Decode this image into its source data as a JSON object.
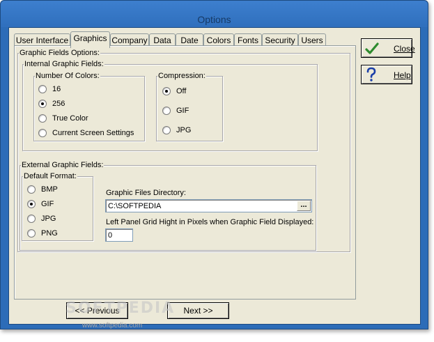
{
  "window": {
    "title": "Options"
  },
  "tabs": [
    {
      "label": "User Interface",
      "active": false
    },
    {
      "label": "Graphics",
      "active": true
    },
    {
      "label": "Company",
      "active": false
    },
    {
      "label": "Data",
      "active": false
    },
    {
      "label": "Date",
      "active": false
    },
    {
      "label": "Colors",
      "active": false
    },
    {
      "label": "Fonts",
      "active": false
    },
    {
      "label": "Security",
      "active": false
    },
    {
      "label": "Users",
      "active": false
    }
  ],
  "graphic_fields": {
    "title": "Graphic Fields Options:",
    "internal": {
      "title": "Internal Graphic Fields:",
      "colors": {
        "title": "Number Of Colors:",
        "options": [
          "16",
          "256",
          "True Color",
          "Current Screen Settings"
        ],
        "selected": "256"
      },
      "compression": {
        "title": "Compression:",
        "options": [
          "Off",
          "GIF",
          "JPG"
        ],
        "selected": "Off"
      }
    },
    "external": {
      "title": "External Graphic Fields:",
      "format": {
        "title": "Default Format:",
        "options": [
          "BMP",
          "GIF",
          "JPG",
          "PNG"
        ],
        "selected": "GIF"
      },
      "directory_label": "Graphic Files Directory:",
      "directory_value": "C:\\SOFTPEDIA",
      "browse_label": "...",
      "grid_height_label": "Left Panel Grid Hight in Pixels when Graphic Field Displayed:",
      "grid_height_value": "0"
    }
  },
  "buttons": {
    "close_label": "Close",
    "help_label": "Help",
    "previous_label": "<< Previous",
    "next_label": "Next >>"
  },
  "watermark": {
    "text": "SOFTPEDIA",
    "sub": "www.softpedia.com"
  },
  "colors": {
    "title_bar": "#2f6fbd",
    "face": "#ece9d8",
    "check_green": "#2e8b2e",
    "help_blue": "#1a3ea8"
  }
}
